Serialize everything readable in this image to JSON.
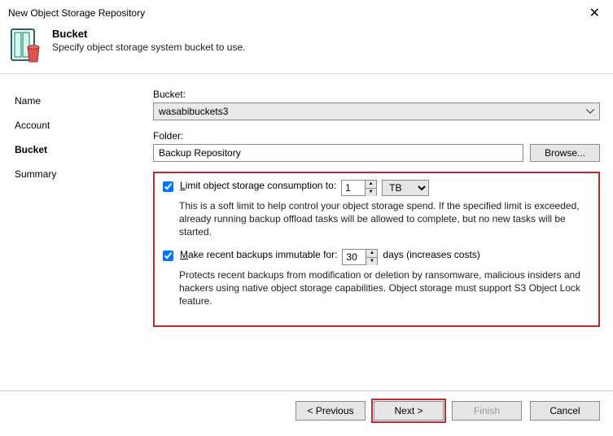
{
  "window": {
    "title": "New Object Storage Repository",
    "close": "✕"
  },
  "header": {
    "heading": "Bucket",
    "subheading": "Specify object storage system bucket to use."
  },
  "sidebar": {
    "items": [
      {
        "label": "Name",
        "active": false
      },
      {
        "label": "Account",
        "active": false
      },
      {
        "label": "Bucket",
        "active": true
      },
      {
        "label": "Summary",
        "active": false
      }
    ]
  },
  "form": {
    "bucket_label": "Bucket:",
    "bucket_value": "wasabibuckets3",
    "folder_label": "Folder:",
    "folder_value": "Backup Repository",
    "browse_label": "Browse...",
    "limit": {
      "checked": true,
      "label_pre": "L",
      "label_rest": "imit object storage consumption to:",
      "value": "1",
      "unit": "TB",
      "desc": "This is a soft limit to help control your object storage spend. If the specified limit is exceeded, already running backup offload tasks will be allowed to complete, but no new tasks will be started."
    },
    "immutable": {
      "checked": true,
      "label_pre": "M",
      "label_rest": "ake recent backups immutable for:",
      "value": "30",
      "suffix": "days (increases costs)",
      "desc": "Protects recent backups from modification or deletion by ransomware, malicious insiders and hackers using native object storage capabilities. Object storage must support S3 Object Lock feature."
    }
  },
  "footer": {
    "previous": "< Previous",
    "next": "Next >",
    "finish": "Finish",
    "cancel": "Cancel"
  }
}
